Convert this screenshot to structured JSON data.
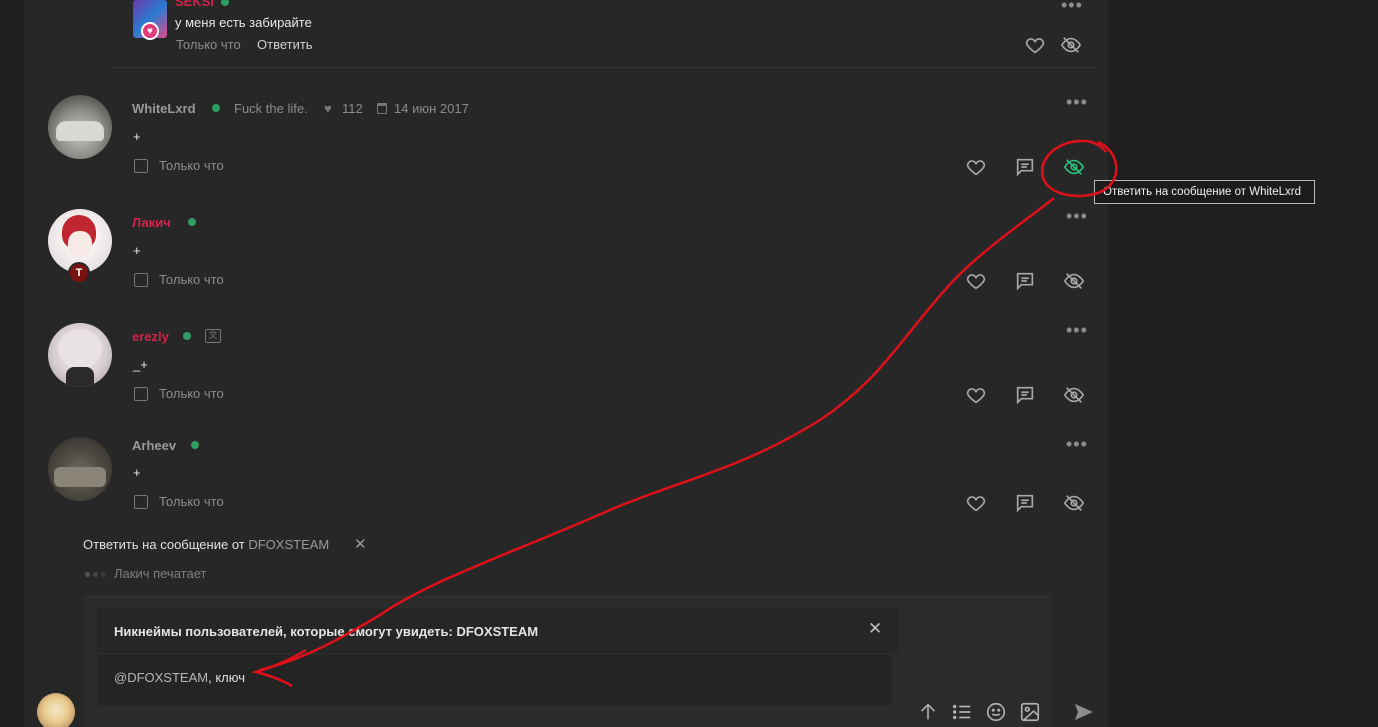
{
  "colors": {
    "panel": "#272727",
    "online": "#2e9e62",
    "accent_red": "#d1234a",
    "hidden_active": "#2ec27e",
    "annotation": "#e0101a"
  },
  "top_comment": {
    "author": "SEKSI",
    "text": "у меня есть забирайте",
    "time": "Только что",
    "reply_label": "Ответить",
    "icons": [
      "heart-icon",
      "eye-off-icon",
      "more-dots-icon"
    ]
  },
  "messages": [
    {
      "author": "WhiteLxrd",
      "status": "Fuck the life.",
      "likes": "112",
      "date": "14 июн 2017",
      "text": "+",
      "time": "Только что"
    },
    {
      "author": "Лакич",
      "text": "+",
      "time": "Только что"
    },
    {
      "author": "erezly",
      "text": "_+",
      "time": "Только что"
    },
    {
      "author": "Arheev",
      "text": "+",
      "time": "Только что"
    }
  ],
  "tooltip": "Ответить на сообщение от WhiteLxrd",
  "reply_bar": {
    "prefix": "Ответить на сообщение от",
    "target": "DFOXSTEAM",
    "close": "✕"
  },
  "typing": "Лакич печатает",
  "composer": {
    "visibility_label": "Никнеймы пользователей, которые смогут увидеть: DFOXSTEAM",
    "close": "✕",
    "mention": "@DFOXSTEAM",
    "text": ", ключ",
    "tools": [
      "arrow-up-icon",
      "list-icon",
      "emoji-icon",
      "image-icon",
      "send-icon"
    ]
  },
  "glyphs": {
    "dots": "•••"
  }
}
